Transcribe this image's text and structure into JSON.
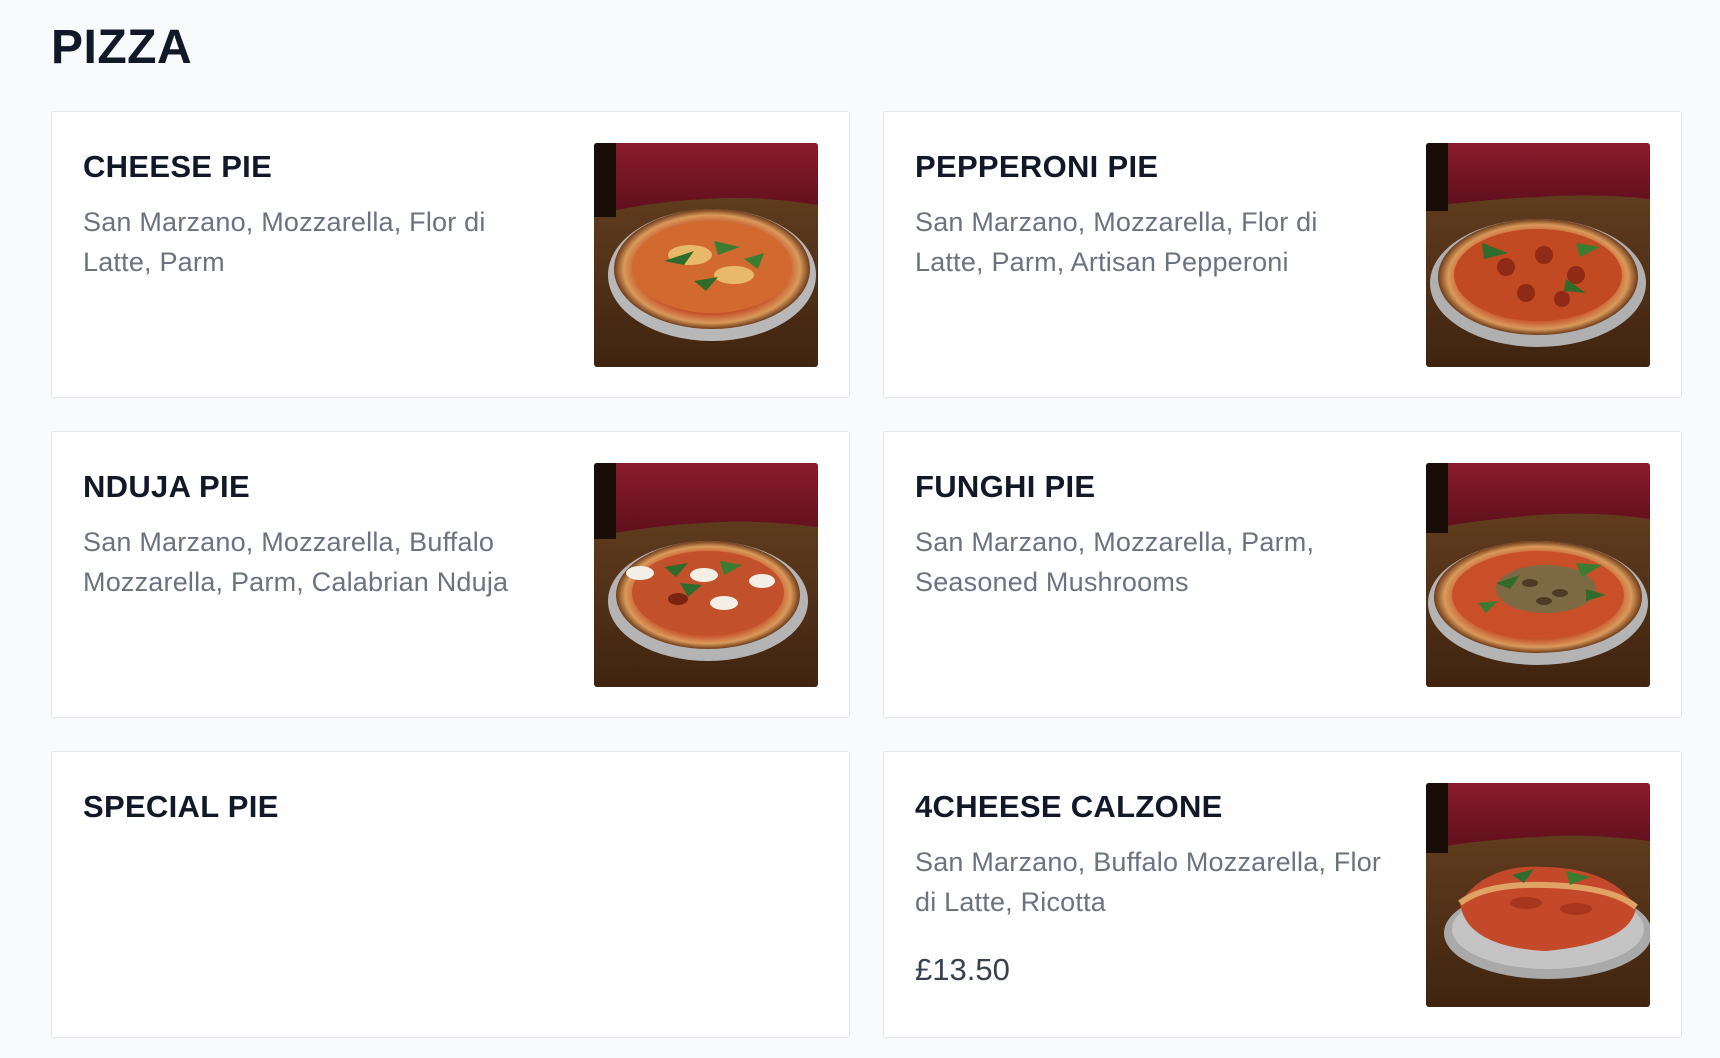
{
  "section": {
    "title": "PIZZA"
  },
  "items": [
    {
      "name": "CHEESE PIE",
      "description": "San Marzano, Mozzarella, Flor di Latte, Parm",
      "price": "",
      "image": "cheese-pie-photo"
    },
    {
      "name": "PEPPERONI PIE",
      "description": "San Marzano, Mozzarella, Flor di Latte, Parm, Artisan Pepperoni",
      "price": "",
      "image": "pepperoni-pie-photo"
    },
    {
      "name": "NDUJA PIE",
      "description": "San Marzano, Mozzarella, Buffalo Mozzarella, Parm, Calabrian Nduja",
      "price": "",
      "image": "nduja-pie-photo"
    },
    {
      "name": "FUNGHI PIE",
      "description": "San Marzano, Mozzarella, Parm, Seasoned Mushrooms",
      "price": "",
      "image": "funghi-pie-photo"
    },
    {
      "name": "SPECIAL PIE",
      "description": "",
      "price": "",
      "image": ""
    },
    {
      "name": "4CHEESE CALZONE",
      "description": "San Marzano, Buffalo Mozzarella, Flor di Latte, Ricotta",
      "price": "£13.50",
      "image": "calzone-photo"
    }
  ],
  "colors": {
    "page_bg": "#f9fafb",
    "card_bg": "#ffffff",
    "card_border": "#e5e7eb",
    "title_text": "#111827",
    "desc_text": "#6b7280",
    "photo_backdrop": "#7a1626",
    "photo_table": "#5a3618"
  }
}
